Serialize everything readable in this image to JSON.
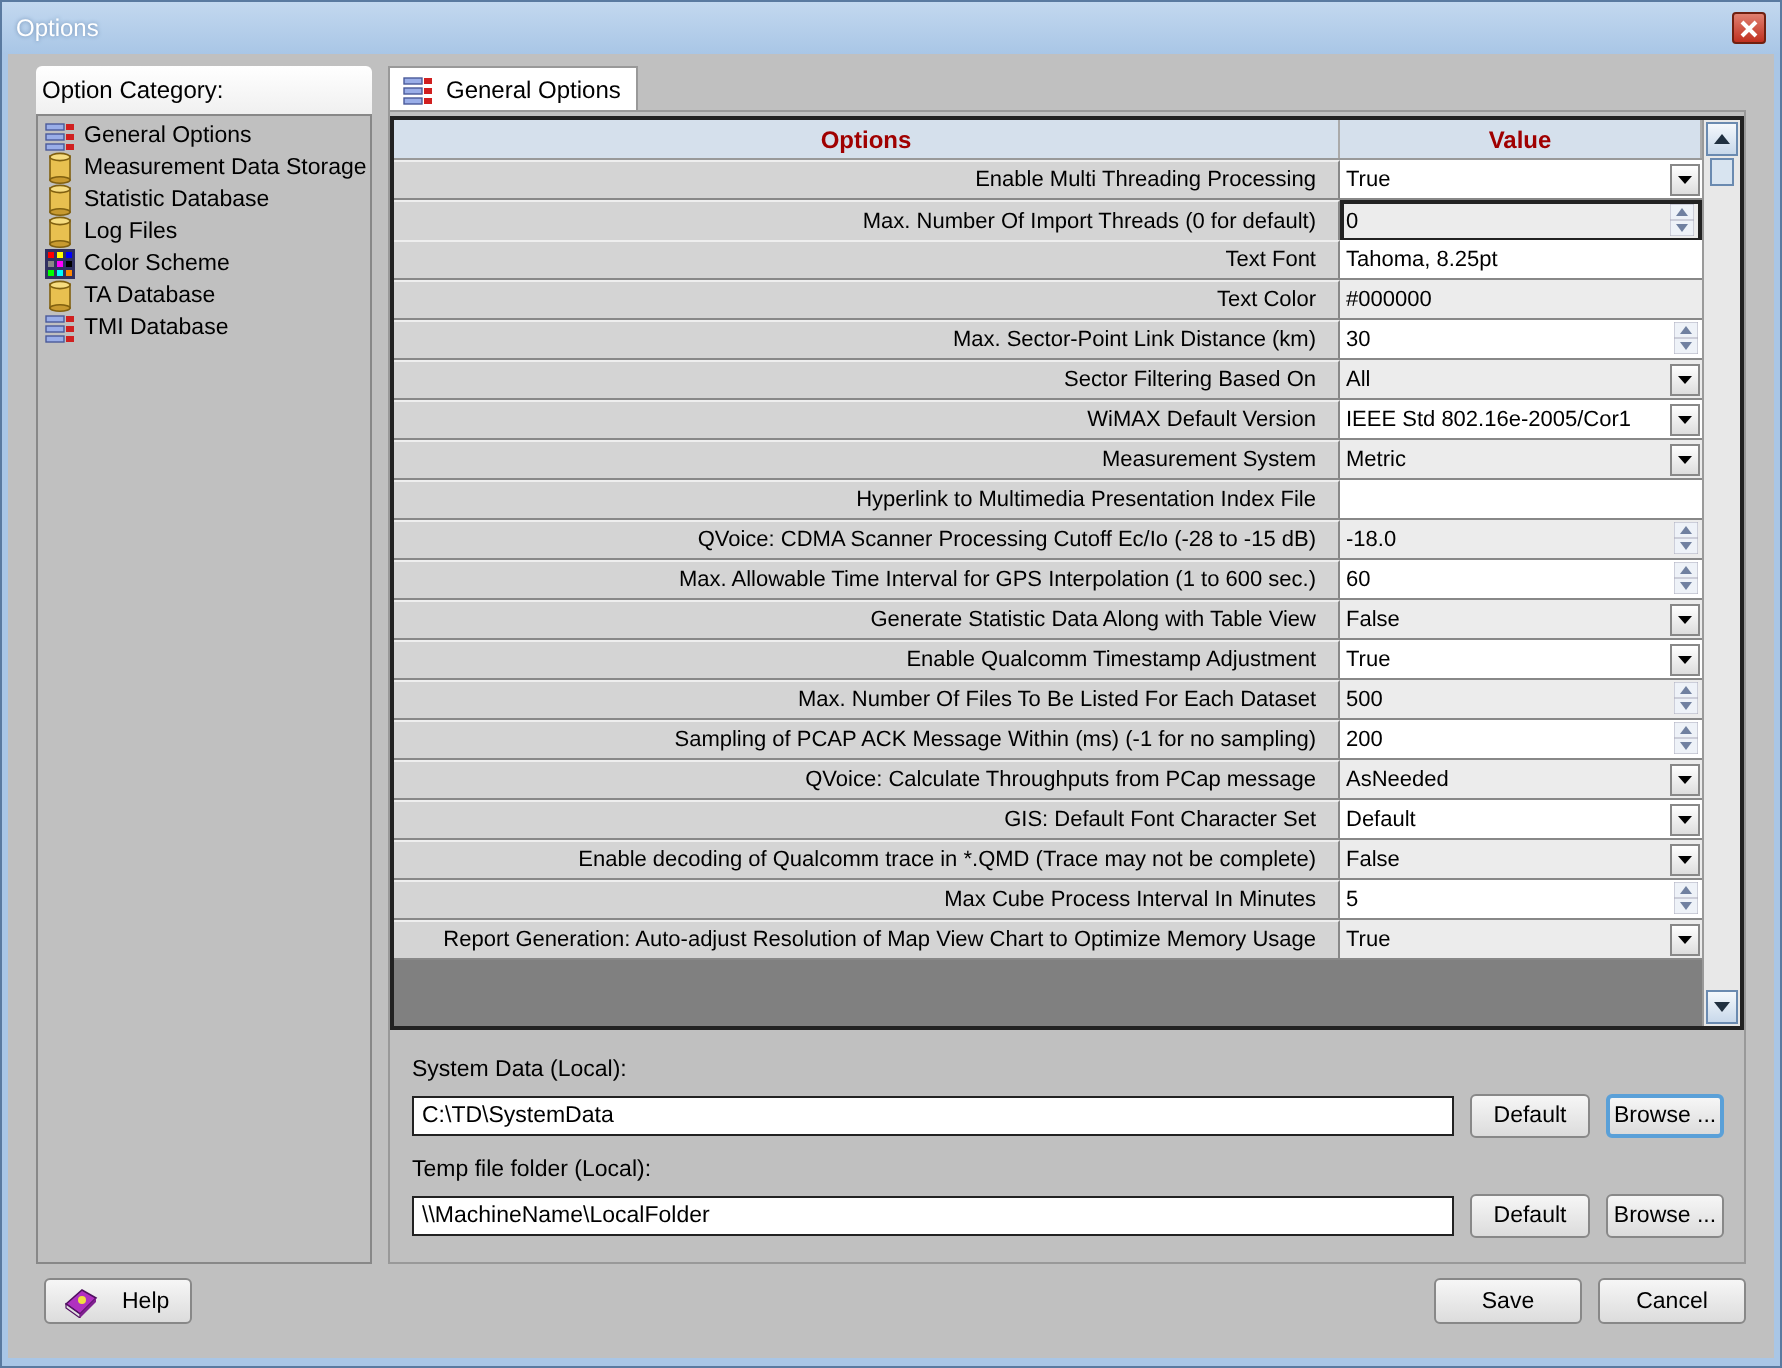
{
  "window": {
    "title": "Options"
  },
  "category_panel": {
    "title": "Option Category:",
    "items": [
      {
        "label": "General Options",
        "kind": "grid"
      },
      {
        "label": "Measurement Data Storage",
        "kind": "database"
      },
      {
        "label": "Statistic Database",
        "kind": "database"
      },
      {
        "label": "Log Files",
        "kind": "database"
      },
      {
        "label": "Color Scheme",
        "kind": "palette"
      },
      {
        "label": "TA Database",
        "kind": "database"
      },
      {
        "label": "TMI Database",
        "kind": "grid"
      }
    ]
  },
  "tabs": [
    {
      "label": "General Options",
      "selected": true
    }
  ],
  "table": {
    "columns": [
      "Options",
      "Value"
    ],
    "rows": [
      {
        "option": "Enable Multi Threading Processing",
        "value": "True",
        "kind": "dropdown",
        "selected": false
      },
      {
        "option": "Max. Number Of Import Threads (0 for default)",
        "value": "0",
        "kind": "spin",
        "selected": true
      },
      {
        "option": "Text Font",
        "value": "Tahoma, 8.25pt",
        "kind": "text",
        "selected": false
      },
      {
        "option": "Text Color",
        "value": "#000000",
        "kind": "text",
        "selected": false
      },
      {
        "option": "Max. Sector-Point Link Distance (km)",
        "value": "30",
        "kind": "spin",
        "selected": false
      },
      {
        "option": "Sector Filtering Based On",
        "value": "All",
        "kind": "dropdown",
        "selected": false
      },
      {
        "option": "WiMAX Default Version",
        "value": "IEEE Std 802.16e-2005/Cor1",
        "kind": "dropdown",
        "selected": false
      },
      {
        "option": "Measurement System",
        "value": "Metric",
        "kind": "dropdown",
        "selected": false
      },
      {
        "option": "Hyperlink to Multimedia Presentation Index File",
        "kind": "text",
        "selected": false
      },
      {
        "option": "QVoice: CDMA Scanner Processing Cutoff Ec/Io (-28 to -15 dB)",
        "value": "-18.0",
        "kind": "spin",
        "selected": false
      },
      {
        "option": "Max. Allowable Time Interval for GPS Interpolation (1 to 600 sec.)",
        "value": "60",
        "kind": "spin",
        "selected": false
      },
      {
        "option": "Generate Statistic Data Along with Table View",
        "value": "False",
        "kind": "dropdown",
        "selected": false
      },
      {
        "option": "Enable Qualcomm Timestamp Adjustment",
        "value": "True",
        "kind": "dropdown",
        "selected": false
      },
      {
        "option": "Max. Number Of Files To Be Listed For Each Dataset",
        "value": "500",
        "kind": "spin",
        "selected": false
      },
      {
        "option": "Sampling of PCAP ACK Message Within (ms) (-1 for no sampling)",
        "value": "200",
        "kind": "spin",
        "selected": false
      },
      {
        "option": "QVoice: Calculate Throughputs from PCap message",
        "value": "AsNeeded",
        "kind": "dropdown",
        "selected": false
      },
      {
        "option": "GIS: Default Font Character Set",
        "value": "Default",
        "kind": "dropdown",
        "selected": false
      },
      {
        "option": "Enable decoding of Qualcomm trace in *.QMD (Trace may not be complete)",
        "value": "False",
        "kind": "dropdown",
        "selected": false
      },
      {
        "option": "Max Cube Process Interval In Minutes",
        "value": "5",
        "kind": "spin",
        "selected": false
      },
      {
        "option": "Report Generation: Auto-adjust Resolution of Map View Chart to Optimize Memory Usage",
        "value": "True",
        "kind": "dropdown",
        "selected": false
      }
    ]
  },
  "paths": [
    {
      "label": "System Data (Local):",
      "value": "C:\\TD\\SystemData",
      "default_button": "Default",
      "browse_button": "Browse ...",
      "focused": true
    },
    {
      "label": "Temp file folder (Local):",
      "value": "\\\\MachineName\\LocalFolder",
      "default_button": "Default",
      "browse_button": "Browse ...",
      "focused": false
    }
  ],
  "buttons": {
    "help": "Help",
    "save": "Save",
    "cancel": "Cancel"
  }
}
